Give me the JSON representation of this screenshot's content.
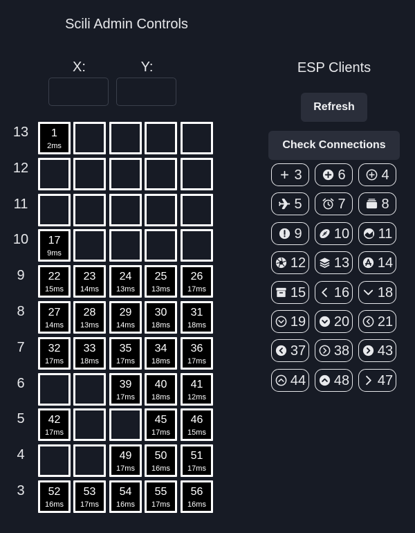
{
  "title": "Scili Admin Controls",
  "coords": {
    "x_label": "X:",
    "y_label": "Y:",
    "x_value": "",
    "y_value": ""
  },
  "grid": {
    "columns": 5,
    "rows": [
      {
        "label": "13",
        "cells": [
          {
            "n": "1",
            "ms": "2ms"
          },
          null,
          null,
          null,
          null
        ]
      },
      {
        "label": "12",
        "cells": [
          null,
          null,
          null,
          null,
          null
        ]
      },
      {
        "label": "11",
        "cells": [
          null,
          null,
          null,
          null,
          null
        ]
      },
      {
        "label": "10",
        "cells": [
          {
            "n": "17",
            "ms": "9ms"
          },
          null,
          null,
          null,
          null
        ]
      },
      {
        "label": "9",
        "cells": [
          {
            "n": "22",
            "ms": "15ms"
          },
          {
            "n": "23",
            "ms": "14ms"
          },
          {
            "n": "24",
            "ms": "13ms"
          },
          {
            "n": "25",
            "ms": "13ms"
          },
          {
            "n": "26",
            "ms": "17ms"
          }
        ]
      },
      {
        "label": "8",
        "cells": [
          {
            "n": "27",
            "ms": "14ms"
          },
          {
            "n": "28",
            "ms": "13ms"
          },
          {
            "n": "29",
            "ms": "14ms"
          },
          {
            "n": "30",
            "ms": "18ms"
          },
          {
            "n": "31",
            "ms": "18ms"
          }
        ]
      },
      {
        "label": "7",
        "cells": [
          {
            "n": "32",
            "ms": "17ms"
          },
          {
            "n": "33",
            "ms": "18ms"
          },
          {
            "n": "35",
            "ms": "17ms"
          },
          {
            "n": "34",
            "ms": "18ms"
          },
          {
            "n": "36",
            "ms": "17ms"
          }
        ]
      },
      {
        "label": "6",
        "cells": [
          null,
          null,
          {
            "n": "39",
            "ms": "17ms"
          },
          {
            "n": "40",
            "ms": "18ms"
          },
          {
            "n": "41",
            "ms": "12ms"
          }
        ]
      },
      {
        "label": "5",
        "cells": [
          {
            "n": "42",
            "ms": "17ms"
          },
          null,
          null,
          {
            "n": "45",
            "ms": "17ms"
          },
          {
            "n": "46",
            "ms": "15ms"
          }
        ]
      },
      {
        "label": "4",
        "cells": [
          null,
          null,
          {
            "n": "49",
            "ms": "17ms"
          },
          {
            "n": "50",
            "ms": "16ms"
          },
          {
            "n": "51",
            "ms": "17ms"
          }
        ]
      },
      {
        "label": "3",
        "cells": [
          {
            "n": "52",
            "ms": "16ms"
          },
          {
            "n": "53",
            "ms": "17ms"
          },
          {
            "n": "54",
            "ms": "16ms"
          },
          {
            "n": "55",
            "ms": "17ms"
          },
          {
            "n": "56",
            "ms": "16ms"
          }
        ]
      }
    ]
  },
  "esp": {
    "title": "ESP Clients",
    "refresh_label": "Refresh",
    "check_label": "Check Connections",
    "clients": [
      {
        "n": "3",
        "icon": "plus-icon"
      },
      {
        "n": "6",
        "icon": "plus-circle-filled-icon"
      },
      {
        "n": "4",
        "icon": "plus-circle-outline-icon"
      },
      {
        "n": "5",
        "icon": "airplane-icon"
      },
      {
        "n": "7",
        "icon": "alarm-clock-icon"
      },
      {
        "n": "8",
        "icon": "albums-icon"
      },
      {
        "n": "9",
        "icon": "alert-circle-icon"
      },
      {
        "n": "10",
        "icon": "american-football-icon"
      },
      {
        "n": "11",
        "icon": "analytics-icon"
      },
      {
        "n": "12",
        "icon": "aperture-icon"
      },
      {
        "n": "13",
        "icon": "layers-icon"
      },
      {
        "n": "14",
        "icon": "app-store-icon"
      },
      {
        "n": "15",
        "icon": "archive-icon"
      },
      {
        "n": "16",
        "icon": "chevron-back-icon"
      },
      {
        "n": "18",
        "icon": "chevron-down-icon"
      },
      {
        "n": "19",
        "icon": "chevron-down-circle-outline-icon"
      },
      {
        "n": "20",
        "icon": "chevron-down-circle-filled-icon"
      },
      {
        "n": "21",
        "icon": "chevron-back-circle-outline-icon"
      },
      {
        "n": "37",
        "icon": "chevron-back-circle-filled-icon"
      },
      {
        "n": "38",
        "icon": "chevron-forward-circle-outline-icon"
      },
      {
        "n": "43",
        "icon": "chevron-forward-circle-filled-icon"
      },
      {
        "n": "44",
        "icon": "chevron-up-circle-outline-icon"
      },
      {
        "n": "48",
        "icon": "chevron-up-circle-filled-icon"
      },
      {
        "n": "47",
        "icon": "chevron-forward-icon"
      }
    ]
  }
}
